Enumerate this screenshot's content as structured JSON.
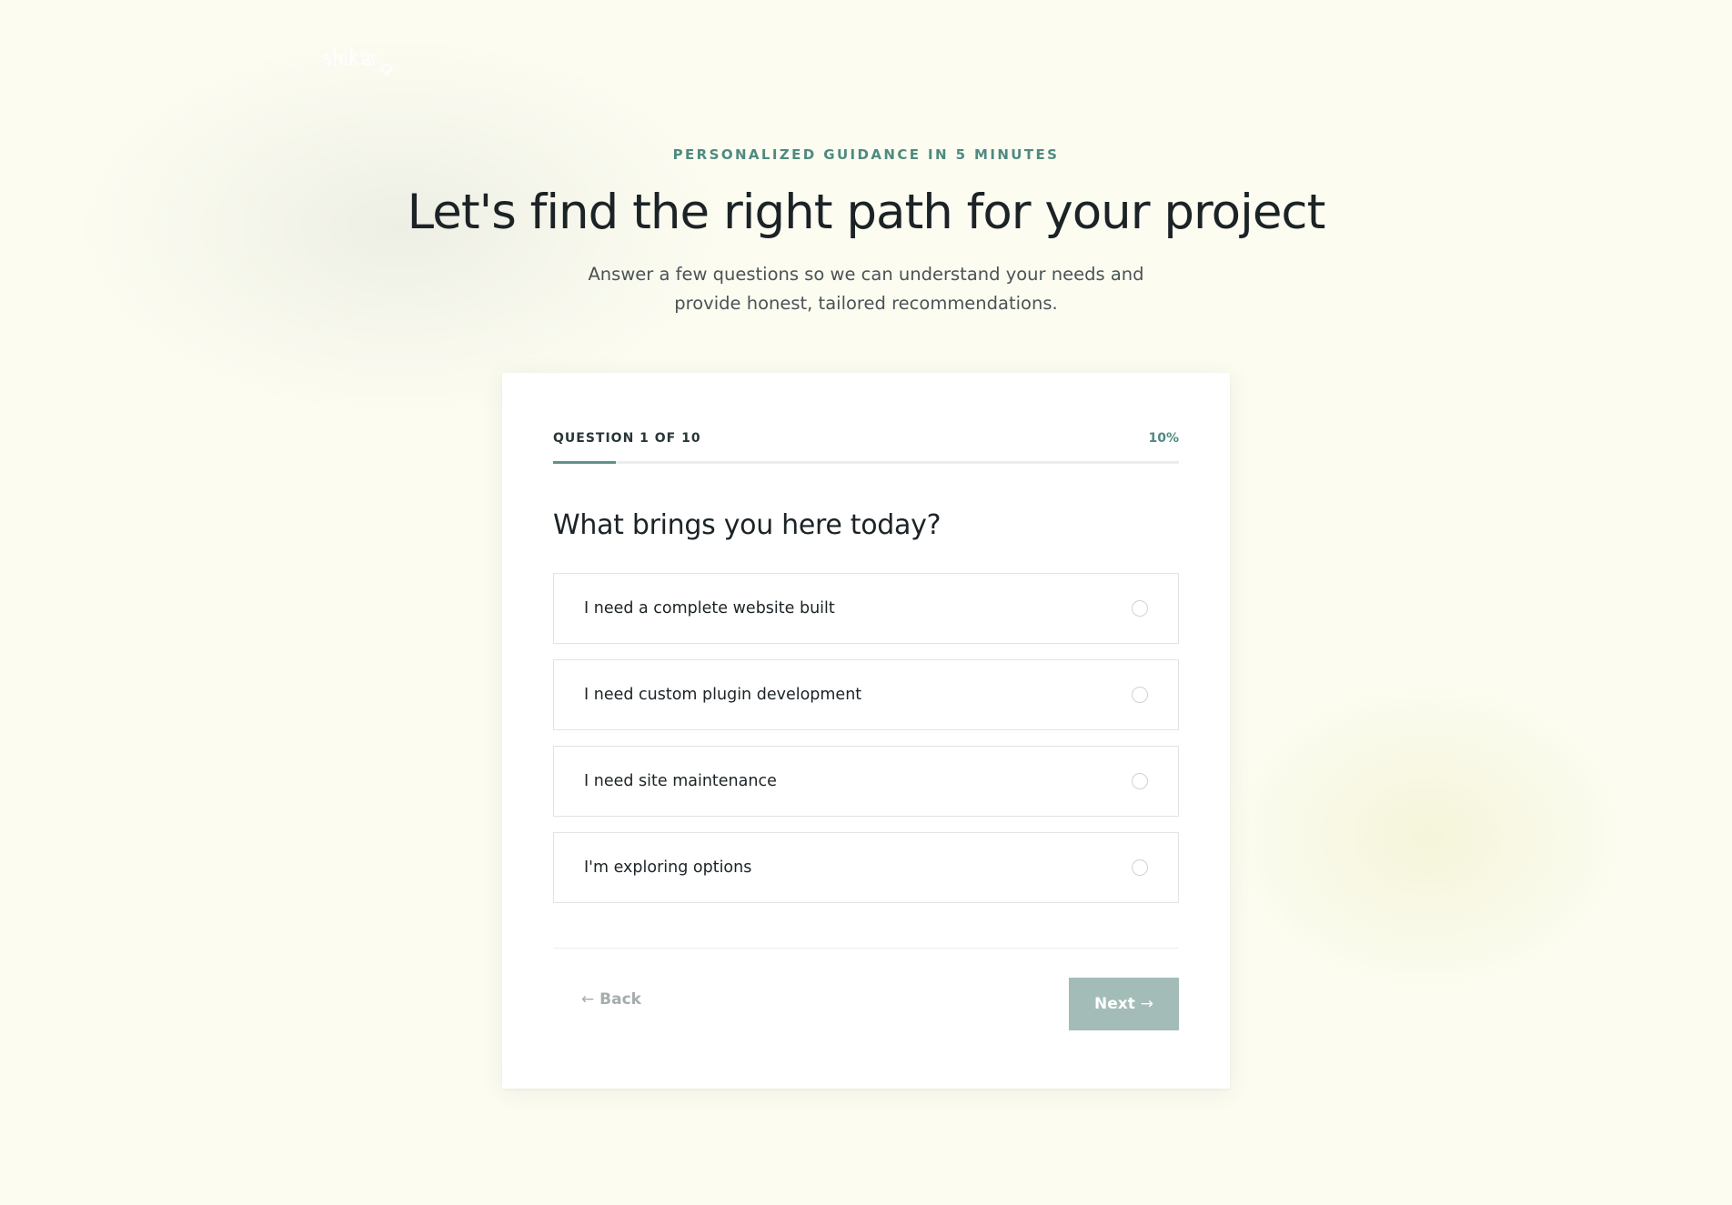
{
  "logo": {
    "icon": "logo-wordmark",
    "color": "#ffffff"
  },
  "hero": {
    "eyebrow": "PERSONALIZED GUIDANCE IN 5 MINUTES",
    "title": "Let's find the right path for your project",
    "subtitle": "Answer a few questions so we can understand your needs and provide honest, tailored recommendations."
  },
  "quiz": {
    "question_count": "QUESTION 1 OF 10",
    "progress_label": "10%",
    "progress_fraction": 0.1,
    "question": "What brings you here today?",
    "options": [
      {
        "label": "I need a complete website built",
        "selected": false
      },
      {
        "label": "I need custom plugin development",
        "selected": false
      },
      {
        "label": "I need site maintenance",
        "selected": false
      },
      {
        "label": "I'm exploring options",
        "selected": false
      }
    ],
    "back_label": "Back",
    "back_icon": "arrow-left-icon",
    "next_label": "Next",
    "next_icon": "arrow-right-icon"
  },
  "colors": {
    "accent": "#4f8a80",
    "progress_fill": "#5f928a",
    "next_button_disabled": "#a3bcb7",
    "background": "#fcfcf1"
  }
}
